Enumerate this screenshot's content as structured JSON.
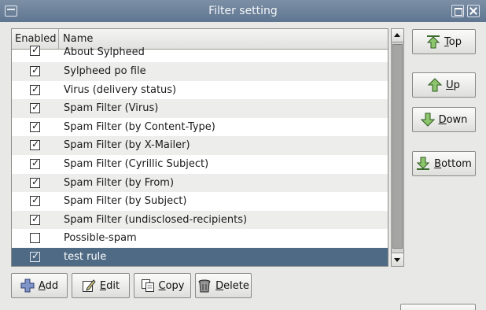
{
  "window": {
    "title": "Filter setting"
  },
  "list": {
    "columns": {
      "enabled": "Enabled",
      "name": "Name"
    },
    "rows": [
      {
        "enabled": true,
        "name": "About Sylpheed"
      },
      {
        "enabled": true,
        "name": "Sylpheed po file"
      },
      {
        "enabled": true,
        "name": "Virus (delivery status)"
      },
      {
        "enabled": true,
        "name": "Spam Filter (Virus)"
      },
      {
        "enabled": true,
        "name": "Spam Filter (by Content-Type)"
      },
      {
        "enabled": true,
        "name": "Spam Filter (by X-Mailer)"
      },
      {
        "enabled": true,
        "name": "Spam Filter (Cyrillic Subject)"
      },
      {
        "enabled": true,
        "name": "Spam Filter (by From)"
      },
      {
        "enabled": true,
        "name": "Spam Filter (by Subject)"
      },
      {
        "enabled": true,
        "name": "Spam Filter (undisclosed-recipients)"
      },
      {
        "enabled": false,
        "name": "Possible-spam"
      },
      {
        "enabled": true,
        "name": "test rule",
        "selected": true
      }
    ]
  },
  "side_buttons": {
    "top": "Top",
    "up": "Up",
    "down": "Down",
    "bottom": "Bottom"
  },
  "bottom_buttons": {
    "add": "Add",
    "edit": "Edit",
    "copy": "Copy",
    "delete": "Delete"
  },
  "check_glyph": "☑",
  "colors": {
    "selection": "#4f6a84",
    "titlebar": "#6b819b"
  }
}
